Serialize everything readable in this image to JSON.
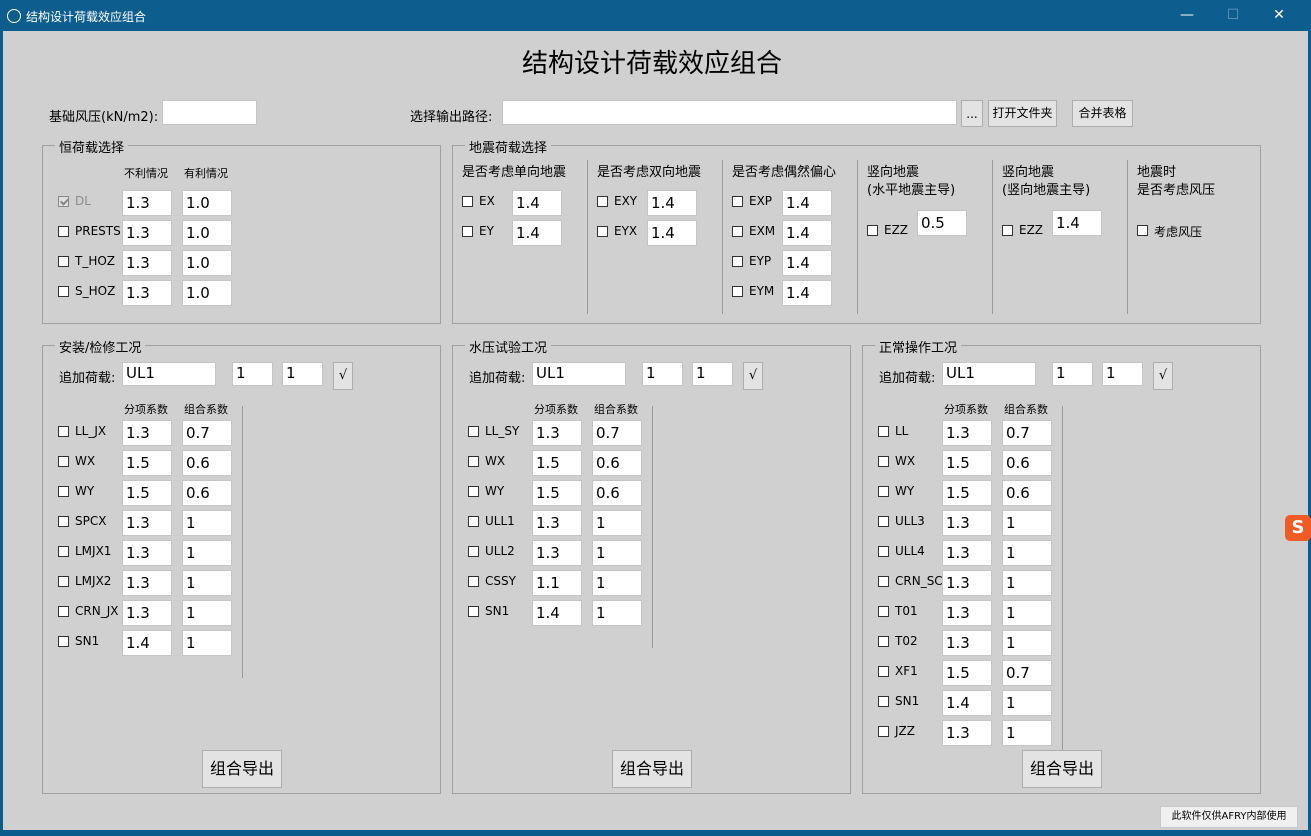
{
  "window": {
    "title": "结构设计荷载效应组合",
    "min": "—",
    "max": "☐",
    "close": "✕"
  },
  "main_title": "结构设计荷载效应组合",
  "top": {
    "wind_label": "基础风压(kN/m2):",
    "wind_value": "",
    "path_label": "选择输出路径:",
    "path_value": "",
    "browse": "...",
    "open_folder": "打开文件夹",
    "merge": "合并表格"
  },
  "dead": {
    "title": "恒荷载选择",
    "h1": "不利情况",
    "h2": "有利情况",
    "rows": [
      {
        "name": "DL",
        "a": "1.3",
        "b": "1.0"
      },
      {
        "name": "PRESTS",
        "a": "1.3",
        "b": "1.0"
      },
      {
        "name": "T_HOZ",
        "a": "1.3",
        "b": "1.0"
      },
      {
        "name": "S_HOZ",
        "a": "1.3",
        "b": "1.0"
      }
    ]
  },
  "seismic": {
    "title": "地震荷载选择",
    "c1": {
      "head": "是否考虑单向地震",
      "rows": [
        {
          "name": "EX",
          "v": "1.4"
        },
        {
          "name": "EY",
          "v": "1.4"
        }
      ]
    },
    "c2": {
      "head": "是否考虑双向地震",
      "rows": [
        {
          "name": "EXY",
          "v": "1.4"
        },
        {
          "name": "EYX",
          "v": "1.4"
        }
      ]
    },
    "c3": {
      "head": "是否考虑偶然偏心",
      "rows": [
        {
          "name": "EXP",
          "v": "1.4"
        },
        {
          "name": "EXM",
          "v": "1.4"
        },
        {
          "name": "EYP",
          "v": "1.4"
        },
        {
          "name": "EYM",
          "v": "1.4"
        }
      ]
    },
    "c4": {
      "head1": "竖向地震",
      "head2": "(水平地震主导)",
      "name": "EZZ",
      "v": "0.5"
    },
    "c5": {
      "head1": "竖向地震",
      "head2": "(竖向地震主导)",
      "name": "EZZ",
      "v": "1.4"
    },
    "c6": {
      "head1": "地震时",
      "head2": "是否考虑风压",
      "name": "考虑风压"
    }
  },
  "panels": [
    {
      "title": "安装/检修工况",
      "add_label": "追加荷载:",
      "add_name": "UL1",
      "add_a": "1",
      "add_b": "1",
      "add_btn": "√",
      "h1": "分项系数",
      "h2": "组合系数",
      "rows": [
        {
          "name": "LL_JX",
          "a": "1.3",
          "b": "0.7"
        },
        {
          "name": "WX",
          "a": "1.5",
          "b": "0.6"
        },
        {
          "name": "WY",
          "a": "1.5",
          "b": "0.6"
        },
        {
          "name": "SPCX",
          "a": "1.3",
          "b": "1"
        },
        {
          "name": "LMJX1",
          "a": "1.3",
          "b": "1"
        },
        {
          "name": "LMJX2",
          "a": "1.3",
          "b": "1"
        },
        {
          "name": "CRN_JX",
          "a": "1.3",
          "b": "1"
        },
        {
          "name": "SN1",
          "a": "1.4",
          "b": "1"
        }
      ],
      "export": "组合导出"
    },
    {
      "title": "水压试验工况",
      "add_label": "追加荷载:",
      "add_name": "UL1",
      "add_a": "1",
      "add_b": "1",
      "add_btn": "√",
      "h1": "分项系数",
      "h2": "组合系数",
      "rows": [
        {
          "name": "LL_SY",
          "a": "1.3",
          "b": "0.7"
        },
        {
          "name": "WX",
          "a": "1.5",
          "b": "0.6"
        },
        {
          "name": "WY",
          "a": "1.5",
          "b": "0.6"
        },
        {
          "name": "ULL1",
          "a": "1.3",
          "b": "1"
        },
        {
          "name": "ULL2",
          "a": "1.3",
          "b": "1"
        },
        {
          "name": "CSSY",
          "a": "1.1",
          "b": "1"
        },
        {
          "name": "SN1",
          "a": "1.4",
          "b": "1"
        }
      ],
      "export": "组合导出"
    },
    {
      "title": "正常操作工况",
      "add_label": "追加荷载:",
      "add_name": "UL1",
      "add_a": "1",
      "add_b": "1",
      "add_btn": "√",
      "h1": "分项系数",
      "h2": "组合系数",
      "rows": [
        {
          "name": "LL",
          "a": "1.3",
          "b": "0.7"
        },
        {
          "name": "WX",
          "a": "1.5",
          "b": "0.6"
        },
        {
          "name": "WY",
          "a": "1.5",
          "b": "0.6"
        },
        {
          "name": "ULL3",
          "a": "1.3",
          "b": "1"
        },
        {
          "name": "ULL4",
          "a": "1.3",
          "b": "1"
        },
        {
          "name": "CRN_SC",
          "a": "1.3",
          "b": "1"
        },
        {
          "name": "T01",
          "a": "1.3",
          "b": "1"
        },
        {
          "name": "T02",
          "a": "1.3",
          "b": "1"
        },
        {
          "name": "XF1",
          "a": "1.5",
          "b": "0.7"
        },
        {
          "name": "SN1",
          "a": "1.4",
          "b": "1"
        },
        {
          "name": "JZZ",
          "a": "1.3",
          "b": "1"
        }
      ],
      "export": "组合导出"
    }
  ],
  "footer": "此软件仅供AFRY内部使用",
  "ime_icon": "S"
}
